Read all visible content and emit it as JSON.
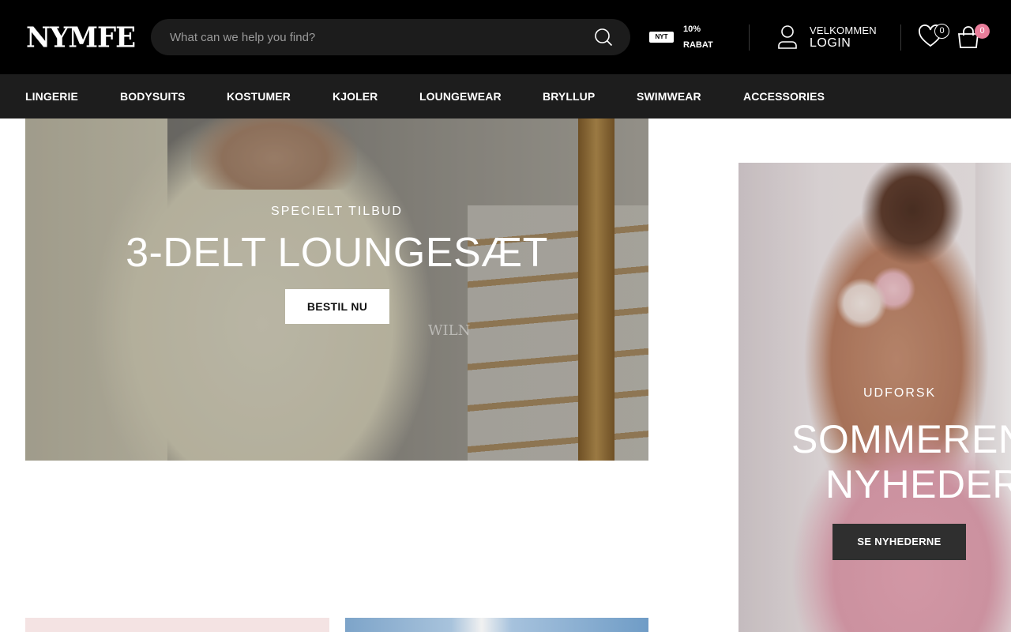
{
  "header": {
    "logo": "NYMFE",
    "search_placeholder": "What can we help you find?",
    "promo": {
      "badge": "NYT",
      "percent": "10%",
      "label": "RABAT"
    },
    "account": {
      "welcome": "VELKOMMEN",
      "login": "LOGIN"
    },
    "wishlist_count": "0",
    "cart_count": "0",
    "colors": {
      "background": "#000000",
      "cart_badge": "#e97d9a"
    }
  },
  "nav": {
    "items": [
      "LINGERIE",
      "BODYSUITS",
      "KOSTUMER",
      "KJOLER",
      "LOUNGEWEAR",
      "BRYLLUP",
      "SWIMWEAR",
      "ACCESSORIES"
    ]
  },
  "banner_main": {
    "eyebrow": "SPECIELT TILBUD",
    "title": "3-DELT LOUNGESÆT",
    "cta": "BESTIL NU",
    "watermark": "WILN"
  },
  "banner_side": {
    "eyebrow": "UDFORSK",
    "title_line1": "SOMMEREN",
    "title_line2": "NYHEDER",
    "cta": "SE NYHEDERNE"
  },
  "icons": [
    "search-icon",
    "user-icon",
    "heart-icon",
    "bag-icon"
  ]
}
